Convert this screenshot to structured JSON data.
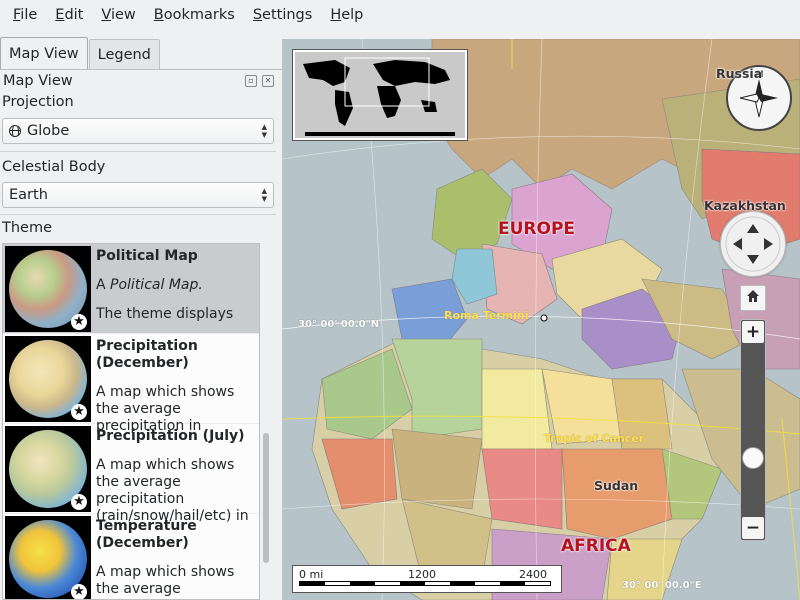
{
  "menubar": {
    "items": [
      {
        "label": "File",
        "mnemonic": "F"
      },
      {
        "label": "Edit",
        "mnemonic": "E"
      },
      {
        "label": "View",
        "mnemonic": "V"
      },
      {
        "label": "Bookmarks",
        "mnemonic": "B"
      },
      {
        "label": "Settings",
        "mnemonic": "S"
      },
      {
        "label": "Help",
        "mnemonic": "H"
      }
    ]
  },
  "panel": {
    "tabs": [
      {
        "label": "Map View",
        "active": true
      },
      {
        "label": "Legend",
        "active": false
      }
    ],
    "dock_title": "Map View",
    "projection_label": "Projection",
    "projection_value": "Globe",
    "celestial_label": "Celestial Body",
    "celestial_value": "Earth",
    "theme_label": "Theme",
    "themes": [
      {
        "title": "Political Map",
        "desc_prefix": "A ",
        "desc_italic": "Political Map.",
        "desc_more": "The theme displays",
        "selected": true,
        "favorite": true
      },
      {
        "title": "Precipitation (December)",
        "desc": "A map which shows the average precipitation in",
        "selected": false,
        "favorite": true
      },
      {
        "title": "Precipitation (July)",
        "desc": "A map which shows the average precipitation (rain/snow/hail/etc) in",
        "selected": false,
        "favorite": true
      },
      {
        "title": "Temperature (December)",
        "desc": "A map which shows the average temperature in",
        "selected": false,
        "favorite": true
      }
    ]
  },
  "map": {
    "labels": {
      "europe": "EUROPE",
      "africa": "AFRICA",
      "russia": "Russia",
      "kazakhstan": "Kazakhstan",
      "sudan": "Sudan",
      "lat_30n": "30° 00' 00.0\"N",
      "lon_east": "30° 00' 00.0\"E",
      "rome": "Roma Termini",
      "tropic": "Tropic of Cancer"
    },
    "scale": {
      "start": "0 mi",
      "mid": "1200",
      "end": "2400"
    },
    "colors": {
      "sea": "#b6c4c9",
      "land_default": "#d9cfa6"
    }
  }
}
